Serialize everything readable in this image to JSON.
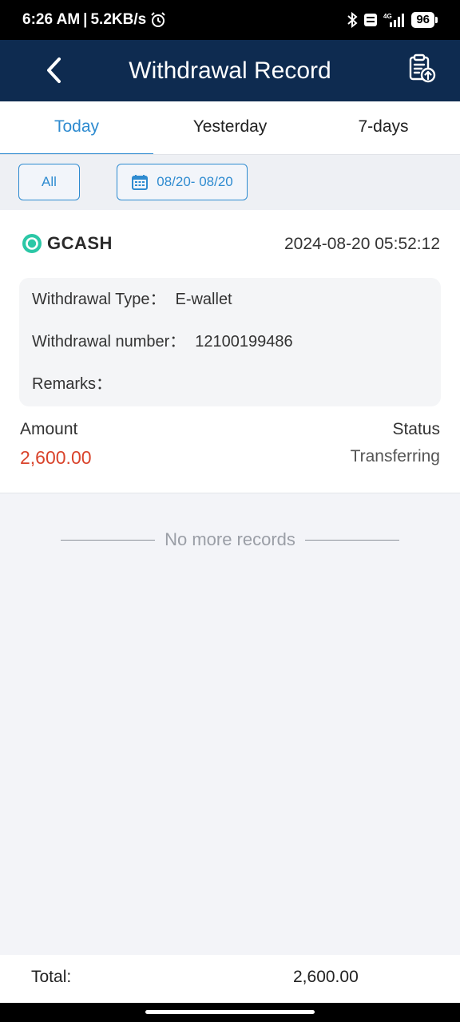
{
  "status_bar": {
    "time": "6:26 AM",
    "separator": "|",
    "network_speed": "5.2KB/s",
    "battery": "96"
  },
  "header": {
    "title": "Withdrawal Record"
  },
  "tabs": [
    {
      "label": "Today",
      "active": true
    },
    {
      "label": "Yesterday",
      "active": false
    },
    {
      "label": "7-days",
      "active": false
    }
  ],
  "filters": {
    "all_label": "All",
    "date_range": "08/20- 08/20"
  },
  "record": {
    "method": "GCASH",
    "datetime": "2024-08-20 05:52:12",
    "type_label": "Withdrawal Type：",
    "type_value": "E-wallet",
    "number_label": "Withdrawal number：",
    "number_value": "12100199486",
    "remarks_label": "Remarks：",
    "remarks_value": "",
    "amount_label": "Amount",
    "amount_value": "2,600.00",
    "status_label": "Status",
    "status_value": "Transferring"
  },
  "end_text": "No more records",
  "footer": {
    "total_label": "Total:",
    "total_value": "2,600.00"
  },
  "colors": {
    "header_bg": "#0e2b50",
    "accent": "#2e8bd0",
    "amount": "#d9432b",
    "gcash": "#2bc7a6"
  }
}
